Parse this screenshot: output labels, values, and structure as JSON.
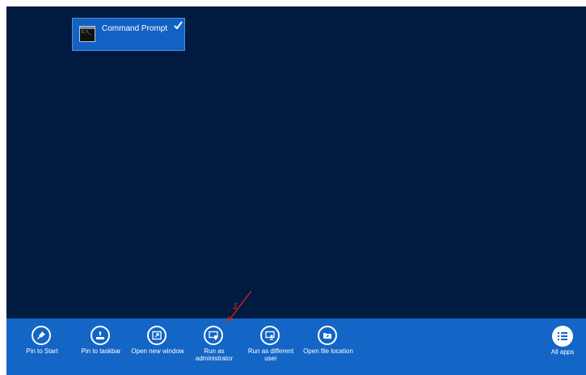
{
  "tile": {
    "label": "Command Prompt",
    "icon": "command-prompt-icon",
    "icon_text": "C:\\_",
    "selected": true
  },
  "app_bar": {
    "commands": [
      {
        "label": "Pin to Start",
        "icon": "pin-icon"
      },
      {
        "label": "Pin to taskbar",
        "icon": "pin-taskbar-icon"
      },
      {
        "label": "Open new window",
        "icon": "new-window-icon"
      },
      {
        "label": "Run as administrator",
        "icon": "shield-icon"
      },
      {
        "label": "Run as different user",
        "icon": "user-window-icon"
      },
      {
        "label": "Open file location",
        "icon": "folder-icon"
      }
    ],
    "all_apps": {
      "label": "All apps",
      "icon": "list-icon"
    }
  },
  "annotation": {
    "label": "1",
    "color": "#e0241b"
  },
  "colors": {
    "background": "#001a40",
    "app_bar": "#1365c6",
    "tile": "#1262c4"
  }
}
